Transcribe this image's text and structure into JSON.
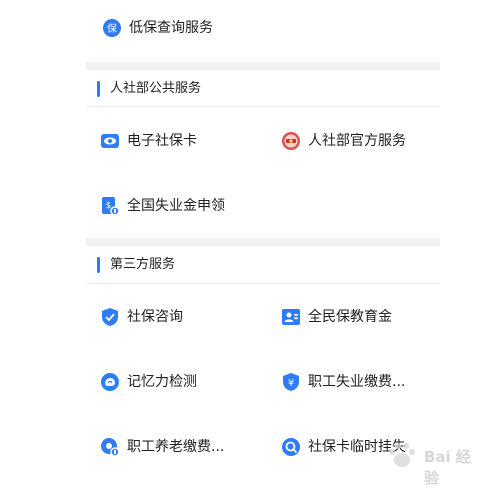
{
  "top_service": {
    "label": "低保查询服务",
    "icon": "shield-bao-icon"
  },
  "sections": [
    {
      "title": "人社部公共服务",
      "items": [
        {
          "label": "电子社保卡",
          "icon": "eye-card-icon"
        },
        {
          "label": "人社部官方服务",
          "icon": "official-emblem-icon"
        },
        {
          "label": "全国失业金申领",
          "icon": "money-document-icon"
        }
      ]
    },
    {
      "title": "第三方服务",
      "items": [
        {
          "label": "社保咨询",
          "icon": "shield-icon"
        },
        {
          "label": "全民保教育金",
          "icon": "person-card-icon"
        },
        {
          "label": "记忆力检测",
          "icon": "brain-cloud-icon"
        },
        {
          "label": "职工失业缴费...",
          "icon": "yuan-shield-icon"
        },
        {
          "label": "职工养老缴费...",
          "icon": "pension-icon"
        },
        {
          "label": "社保卡临时挂失",
          "icon": "search-lock-icon"
        }
      ]
    }
  ],
  "watermark": {
    "text": "Bai 经验"
  },
  "colors": {
    "accent": "#2f7cf6",
    "divider": "#f2f2f4",
    "official": "#d9534f"
  }
}
